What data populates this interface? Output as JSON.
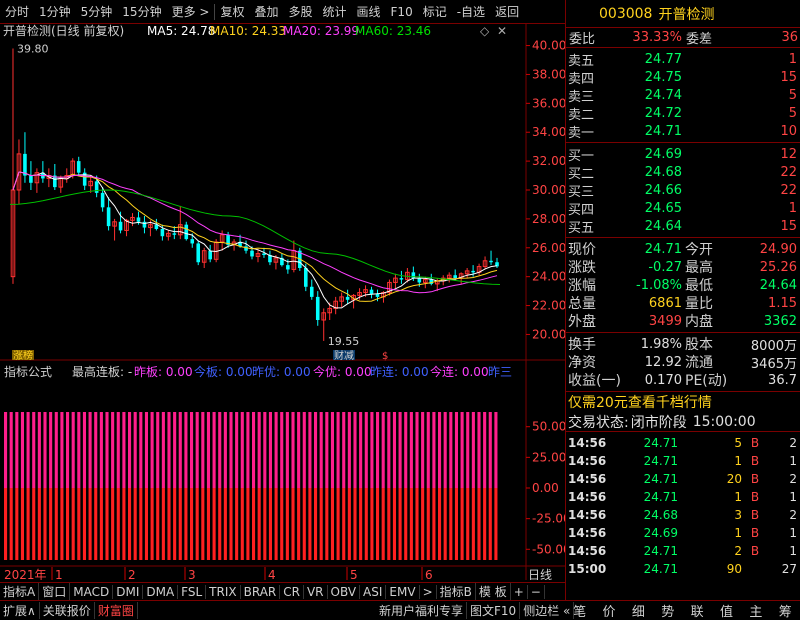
{
  "toolbar": {
    "items": [
      "分时",
      "1分钟",
      "5分钟",
      "15分钟",
      "更多 >",
      "复权",
      "叠加",
      "多股",
      "统计",
      "画线",
      "F10",
      "标记",
      "-自选",
      "返回"
    ]
  },
  "chart_header": {
    "title": "开普检测(日线 前复权)",
    "ma5": "MA5: 24.78",
    "ma10": "MA10: 24.33",
    "ma20": "MA20: 23.99",
    "ma60": "MA60: 23.46"
  },
  "colors": {
    "ma5": "#ffffff",
    "ma10": "#ffd21e",
    "ma20": "#ff40ff",
    "ma60": "#00c000",
    "up": "#ff3030",
    "down": "#00ffff",
    "accent": "#7a0000"
  },
  "markers": {
    "high": "39.80",
    "low": "19.55",
    "tag1": "涨榜",
    "tag2": "财减",
    "tag3": "$"
  },
  "indicator_header": {
    "name": "指标公式",
    "title": "最高连板: -",
    "items": [
      "昨板: 0.00",
      "今板: 0.00",
      "昨优: 0.00",
      "今优: 0.00",
      "昨连: 0.00",
      "今连: 0.00",
      "昨三"
    ]
  },
  "indicator_axis": [
    "50.00",
    "25.00",
    "0.00",
    "-25.00",
    "-50.00"
  ],
  "time_axis": {
    "year": "2021年",
    "months": [
      "1",
      "2",
      "3",
      "4",
      "5",
      "6"
    ],
    "period": "日线"
  },
  "chart_data": {
    "type": "candlestick",
    "y_ticks": [
      "40.00",
      "38.00",
      "36.00",
      "34.00",
      "32.00",
      "30.00",
      "28.00",
      "26.00",
      "24.00",
      "22.00",
      "20.00"
    ],
    "ylim": [
      19.2,
      40.8
    ],
    "candles": [
      [
        24.0,
        39.8,
        23.5,
        30.0
      ],
      [
        30.0,
        33.5,
        29.0,
        32.5
      ],
      [
        32.5,
        34.0,
        30.5,
        31.0
      ],
      [
        31.0,
        32.0,
        30.0,
        30.5
      ],
      [
        30.5,
        31.5,
        29.8,
        31.2
      ],
      [
        31.2,
        32.0,
        30.5,
        30.8
      ],
      [
        30.8,
        31.5,
        30.2,
        31.0
      ],
      [
        31.0,
        31.8,
        30.0,
        30.2
      ],
      [
        30.2,
        31.0,
        29.8,
        30.8
      ],
      [
        30.8,
        31.5,
        30.5,
        31.0
      ],
      [
        31.0,
        32.2,
        30.8,
        32.0
      ],
      [
        32.0,
        32.3,
        31.0,
        31.2
      ],
      [
        31.2,
        31.5,
        30.0,
        30.3
      ],
      [
        30.3,
        31.0,
        29.8,
        30.6
      ],
      [
        30.6,
        31.0,
        29.5,
        29.8
      ],
      [
        29.8,
        30.2,
        28.5,
        28.8
      ],
      [
        28.8,
        29.5,
        27.2,
        27.5
      ],
      [
        27.5,
        28.0,
        26.5,
        27.8
      ],
      [
        27.8,
        28.5,
        27.0,
        27.2
      ],
      [
        27.2,
        28.0,
        26.8,
        27.9
      ],
      [
        27.9,
        28.4,
        27.5,
        28.1
      ],
      [
        28.1,
        28.5,
        27.6,
        27.8
      ],
      [
        27.8,
        28.2,
        27.0,
        27.4
      ],
      [
        27.4,
        27.9,
        26.8,
        27.6
      ],
      [
        27.6,
        28.0,
        27.2,
        27.3
      ],
      [
        27.3,
        27.6,
        26.5,
        26.8
      ],
      [
        26.8,
        27.2,
        26.5,
        27.0
      ],
      [
        27.0,
        27.5,
        26.6,
        26.9
      ],
      [
        26.9,
        28.9,
        26.6,
        27.6
      ],
      [
        27.6,
        27.8,
        26.5,
        26.6
      ],
      [
        26.6,
        27.0,
        26.0,
        26.3
      ],
      [
        26.3,
        26.5,
        24.8,
        25.0
      ],
      [
        25.0,
        26.0,
        24.6,
        25.8
      ],
      [
        25.8,
        26.2,
        25.0,
        25.2
      ],
      [
        25.2,
        26.6,
        25.0,
        26.4
      ],
      [
        26.4,
        27.2,
        25.8,
        26.9
      ],
      [
        26.9,
        27.1,
        26.0,
        26.2
      ],
      [
        26.2,
        26.6,
        25.8,
        26.4
      ],
      [
        26.4,
        26.9,
        26.0,
        26.1
      ],
      [
        26.1,
        26.5,
        25.6,
        25.8
      ],
      [
        25.8,
        26.1,
        25.2,
        25.4
      ],
      [
        25.4,
        25.9,
        25.0,
        25.6
      ],
      [
        25.6,
        26.0,
        25.3,
        25.5
      ],
      [
        25.5,
        25.8,
        24.8,
        25.0
      ],
      [
        25.0,
        25.5,
        24.5,
        25.3
      ],
      [
        25.3,
        25.6,
        24.7,
        24.8
      ],
      [
        24.8,
        25.2,
        24.2,
        24.5
      ],
      [
        24.5,
        26.5,
        24.3,
        25.8
      ],
      [
        25.8,
        26.0,
        24.4,
        24.6
      ],
      [
        24.6,
        24.9,
        23.0,
        23.3
      ],
      [
        23.3,
        23.8,
        22.4,
        22.6
      ],
      [
        22.6,
        23.0,
        20.6,
        21.0
      ],
      [
        21.0,
        21.8,
        19.55,
        21.5
      ],
      [
        21.5,
        22.2,
        21.0,
        21.8
      ],
      [
        21.8,
        22.6,
        21.4,
        22.3
      ],
      [
        22.3,
        22.9,
        21.9,
        22.6
      ],
      [
        22.6,
        23.1,
        22.1,
        22.4
      ],
      [
        22.4,
        22.8,
        21.8,
        22.7
      ],
      [
        22.7,
        23.2,
        22.4,
        22.9
      ],
      [
        22.9,
        23.4,
        22.6,
        23.1
      ],
      [
        23.1,
        23.3,
        22.5,
        22.8
      ],
      [
        22.8,
        23.1,
        22.3,
        22.6
      ],
      [
        22.6,
        23.0,
        22.2,
        22.9
      ],
      [
        22.9,
        23.8,
        22.7,
        23.6
      ],
      [
        23.6,
        24.2,
        23.2,
        23.9
      ],
      [
        23.9,
        24.4,
        23.5,
        23.8
      ],
      [
        23.8,
        24.6,
        23.6,
        24.3
      ],
      [
        24.3,
        24.7,
        23.7,
        23.9
      ],
      [
        23.9,
        24.2,
        23.3,
        23.6
      ],
      [
        23.6,
        24.0,
        23.2,
        23.8
      ],
      [
        23.8,
        24.2,
        23.4,
        23.5
      ],
      [
        23.5,
        23.9,
        23.0,
        23.7
      ],
      [
        23.7,
        24.1,
        23.4,
        23.9
      ],
      [
        23.9,
        24.3,
        23.6,
        24.1
      ],
      [
        24.1,
        24.5,
        23.7,
        23.9
      ],
      [
        23.9,
        24.3,
        23.5,
        24.2
      ],
      [
        24.2,
        24.6,
        23.9,
        24.4
      ],
      [
        24.4,
        24.8,
        24.0,
        24.3
      ],
      [
        24.3,
        24.9,
        24.1,
        24.7
      ],
      [
        24.7,
        25.4,
        24.5,
        25.1
      ],
      [
        25.1,
        25.8,
        24.8,
        25.0
      ],
      [
        25.0,
        25.3,
        24.6,
        24.71
      ]
    ]
  },
  "quote": {
    "code": "003008",
    "name": "开普检测",
    "weibi_label": "委比",
    "weibi": "33.33%",
    "weicha_label": "委差",
    "weicha": "36",
    "asks": [
      {
        "label": "卖五",
        "price": "24.77",
        "vol": "1"
      },
      {
        "label": "卖四",
        "price": "24.75",
        "vol": "15"
      },
      {
        "label": "卖三",
        "price": "24.74",
        "vol": "5"
      },
      {
        "label": "卖二",
        "price": "24.72",
        "vol": "5"
      },
      {
        "label": "卖一",
        "price": "24.71",
        "vol": "10"
      }
    ],
    "bids": [
      {
        "label": "买一",
        "price": "24.69",
        "vol": "12"
      },
      {
        "label": "买二",
        "price": "24.68",
        "vol": "22"
      },
      {
        "label": "买三",
        "price": "24.66",
        "vol": "22"
      },
      {
        "label": "买四",
        "price": "24.65",
        "vol": "1"
      },
      {
        "label": "买五",
        "price": "24.64",
        "vol": "15"
      }
    ],
    "stats": [
      {
        "l1": "现价",
        "v1": "24.71",
        "c1": "grn",
        "l2": "今开",
        "v2": "24.90",
        "c2": "red"
      },
      {
        "l1": "涨跌",
        "v1": "-0.27",
        "c1": "grn",
        "l2": "最高",
        "v2": "25.26",
        "c2": "red"
      },
      {
        "l1": "涨幅",
        "v1": "-1.08%",
        "c1": "grn",
        "l2": "最低",
        "v2": "24.64",
        "c2": "grn"
      },
      {
        "l1": "总量",
        "v1": "6861",
        "c1": "yel",
        "l2": "量比",
        "v2": "1.15",
        "c2": "red"
      },
      {
        "l1": "外盘",
        "v1": "3499",
        "c1": "red",
        "l2": "内盘",
        "v2": "3362",
        "c2": "grn"
      }
    ],
    "fund": [
      {
        "l1": "换手",
        "v1": "1.98%",
        "l2": "股本",
        "v2": "8000万"
      },
      {
        "l1": "净资",
        "v1": "12.92",
        "l2": "流通",
        "v2": "3465万"
      },
      {
        "l1": "收益(一)",
        "v1": "0.170",
        "l2": "PE(动)",
        "v2": "36.7"
      }
    ],
    "promo": "仅需20元查看千档行情",
    "status_label": "交易状态:",
    "status": "闭市阶段",
    "status_time": "15:00:00",
    "ticks": [
      {
        "t": "14:56",
        "p": "24.71",
        "v": "5",
        "bs": "B",
        "n": "2"
      },
      {
        "t": "14:56",
        "p": "24.71",
        "v": "1",
        "bs": "B",
        "n": "1"
      },
      {
        "t": "14:56",
        "p": "24.71",
        "v": "20",
        "bs": "B",
        "n": "2"
      },
      {
        "t": "14:56",
        "p": "24.71",
        "v": "1",
        "bs": "B",
        "n": "1"
      },
      {
        "t": "14:56",
        "p": "24.68",
        "v": "3",
        "bs": "B",
        "n": "2"
      },
      {
        "t": "14:56",
        "p": "24.69",
        "v": "1",
        "bs": "B",
        "n": "1"
      },
      {
        "t": "14:56",
        "p": "24.71",
        "v": "2",
        "bs": "B",
        "n": "1"
      },
      {
        "t": "15:00",
        "p": "24.71",
        "v": "90",
        "bs": "",
        "n": "27"
      }
    ]
  },
  "indicator_tabs": [
    "指标A",
    "窗口",
    "MACD",
    "DMI",
    "DMA",
    "FSL",
    "TRIX",
    "BRAR",
    "CR",
    "VR",
    "OBV",
    "ASI",
    "EMV",
    ">",
    "指标B",
    "模 板",
    "+",
    "−"
  ],
  "bottom": {
    "left": [
      "扩展∧",
      "关联报价",
      "财富圈"
    ],
    "mid": [
      "新用户福利专享",
      "图文F10",
      "侧边栏 «"
    ],
    "right": [
      "笔",
      "价",
      "细",
      "势",
      "联",
      "值",
      "主",
      "筹"
    ]
  }
}
